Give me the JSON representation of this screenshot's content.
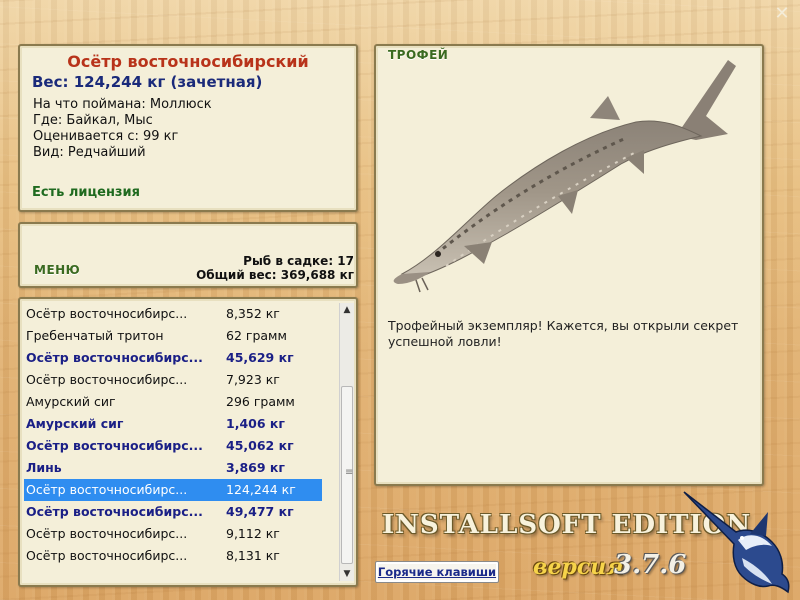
{
  "window": {
    "close_glyph": "✕"
  },
  "info": {
    "title": "Осётр восточносибирский",
    "weight": "Вес: 124,244 кг (зачетная)",
    "bait": "На что поймана: Моллюск",
    "location": "Где: Байкал, Мыс",
    "value": "Оценивается с: 99 кг",
    "rarity": "Вид: Редчайший",
    "license": "Есть лицензия"
  },
  "menu": {
    "label": "МЕНЮ",
    "fish_count": "Рыб в садке: 17",
    "total_weight": "Общий вес: 369,688 кг"
  },
  "catch_list": [
    {
      "name": "Осётр восточносибирс...",
      "weight": "8,352 кг",
      "bold": false,
      "selected": false
    },
    {
      "name": "Гребенчатый тритон",
      "weight": "62 грамм",
      "bold": false,
      "selected": false
    },
    {
      "name": "Осётр восточносибирс...",
      "weight": "45,629 кг",
      "bold": true,
      "selected": false
    },
    {
      "name": "Осётр восточносибирс...",
      "weight": "7,923 кг",
      "bold": false,
      "selected": false
    },
    {
      "name": "Амурский сиг",
      "weight": "296 грамм",
      "bold": false,
      "selected": false
    },
    {
      "name": "Амурский сиг",
      "weight": "1,406 кг",
      "bold": true,
      "selected": false
    },
    {
      "name": "Осётр восточносибирс...",
      "weight": "45,062 кг",
      "bold": true,
      "selected": false
    },
    {
      "name": "Линь",
      "weight": "3,869 кг",
      "bold": true,
      "selected": false
    },
    {
      "name": "Осётр восточносибирс...",
      "weight": "124,244 кг",
      "bold": false,
      "selected": true
    },
    {
      "name": "Осётр восточносибирс...",
      "weight": "49,477 кг",
      "bold": true,
      "selected": false
    },
    {
      "name": "Осётр восточносибирс...",
      "weight": "9,112 кг",
      "bold": false,
      "selected": false
    },
    {
      "name": "Осётр восточносибирс...",
      "weight": "8,131 кг",
      "bold": false,
      "selected": false
    }
  ],
  "trophy": {
    "label": "ТРОФЕЙ",
    "image": "sturgeon-image",
    "text": "Трофейный экземпляр! Кажется, вы открыли секрет успешной ловли!"
  },
  "branding": {
    "name": "INSTALLSOFT EDITION",
    "version_word": "версия",
    "version_number": "3.7.6",
    "logo": "marlin-icon"
  },
  "hotkeys_button": "Горячие клавиши",
  "colors": {
    "title": "#b8331a",
    "bold_entry": "#1a1f86",
    "license": "#1f6a1f",
    "selection": "#2f8df0"
  }
}
